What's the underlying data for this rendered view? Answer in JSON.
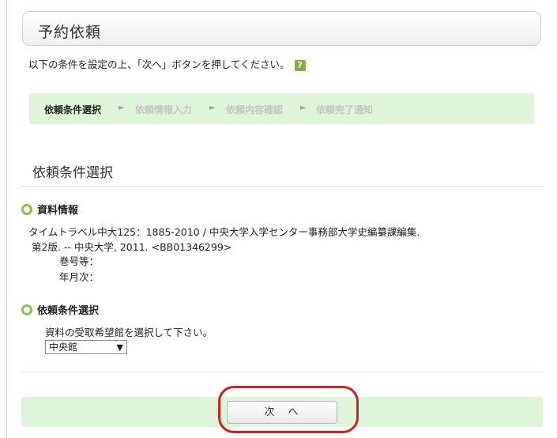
{
  "page": {
    "title": "予約依頼",
    "instruction": "以下の条件を設定の上、「次へ」ボタンを押してください。",
    "help_icon_text": "?"
  },
  "steps": [
    {
      "label": "依頼条件選択",
      "state": "active"
    },
    {
      "label": "依頼情報入力",
      "state": "inactive"
    },
    {
      "label": "依頼内容確認",
      "state": "inactive"
    },
    {
      "label": "依頼完了通知",
      "state": "inactive"
    }
  ],
  "step_arrow": "►",
  "section": {
    "title": "依頼条件選択"
  },
  "material": {
    "heading": "資料情報",
    "line1": "タイムトラベル中大125：1885-2010 / 中央大学入学センター事務部大学史編纂課編集.",
    "line2": "第2版. -- 中央大学, 2011.  <BB01346299>",
    "volume_label": "巻号等：",
    "date_label": "年月次："
  },
  "condition": {
    "heading": "依頼条件選択",
    "prompt": "資料の受取希望館を選択して下さい。",
    "library_selected": "中央館"
  },
  "footer": {
    "next_label": "次　へ"
  },
  "colors": {
    "accent_green": "#8bc34a",
    "step_bar_bg": "#dff5da",
    "highlight_red": "#d62020"
  }
}
